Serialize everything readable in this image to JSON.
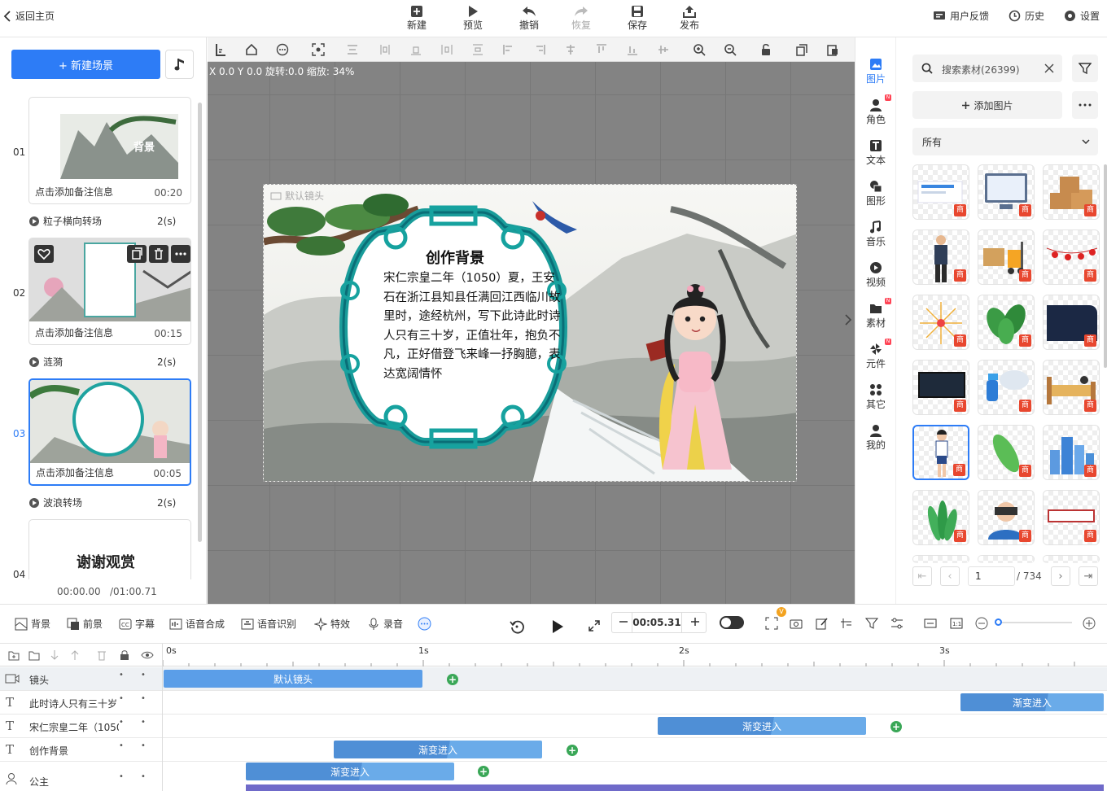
{
  "topbar": {
    "back": "返回主页",
    "new": "新建",
    "preview": "预览",
    "undo": "撤销",
    "redo": "恢复",
    "save": "保存",
    "publish": "发布",
    "feedback": "用户反馈",
    "history": "历史",
    "settings": "设置"
  },
  "left": {
    "new_scene": "+ 新建场景",
    "scenes": [
      {
        "num": "01",
        "note": "点击添加备注信息",
        "time": "00:20",
        "thumb_text": "背景"
      },
      {
        "num": "02",
        "note": "点击添加备注信息",
        "time": "00:15"
      },
      {
        "num": "03",
        "note": "点击添加备注信息",
        "time": "00:05"
      },
      {
        "num": "04",
        "thumb_text": "谢谢观赏"
      }
    ],
    "transitions": [
      {
        "name": "粒子横向转场",
        "dur": "2(s)"
      },
      {
        "name": "涟漪",
        "dur": "2(s)"
      },
      {
        "name": "波浪转场",
        "dur": "2(s)"
      }
    ],
    "time_current": "00:00.00",
    "time_total": "/01:00.71"
  },
  "canvas": {
    "coords": "X 0.0  Y 0.0  旋转:0.0  缩放: 34%",
    "camera_label": "默认镜头",
    "title": "创作背景",
    "body": "宋仁宗皇二年（1050）夏，王安石在浙江县知县任满回江西临川故里时，途经杭州，写下此诗此时诗人只有三十岁，正值壮年，抱负不凡，正好借登飞来峰一抒胸臆，表达宽阔情怀"
  },
  "iconcol": [
    {
      "label": "图片",
      "badge": ""
    },
    {
      "label": "角色",
      "badge": "N"
    },
    {
      "label": "文本",
      "badge": ""
    },
    {
      "label": "图形",
      "badge": ""
    },
    {
      "label": "音乐",
      "badge": ""
    },
    {
      "label": "视频",
      "badge": ""
    },
    {
      "label": "素材",
      "badge": "N"
    },
    {
      "label": "元件",
      "badge": "N"
    },
    {
      "label": "其它",
      "badge": ""
    },
    {
      "label": "我的",
      "badge": ""
    }
  ],
  "assets": {
    "search_placeholder": "搜索素材(26399)",
    "add_image": "添加图片",
    "filter_value": "所有",
    "tag": "商",
    "page": "1",
    "total": "/ 734"
  },
  "bottom": {
    "items": [
      "背景",
      "前景",
      "字幕",
      "语音合成",
      "语音识别",
      "特效",
      "录音"
    ],
    "time": "00:05.31"
  },
  "timeline": {
    "ruler": [
      "0s",
      "1s",
      "2s",
      "3s"
    ],
    "rows": [
      {
        "name": "镜头",
        "bars": [
          {
            "label": "默认镜头"
          }
        ]
      },
      {
        "name": "此时诗人只有三十岁",
        "bars": [
          {
            "label": "渐变进入"
          }
        ]
      },
      {
        "name": "宋仁宗皇二年（1050",
        "bars": [
          {
            "label": "渐变进入"
          }
        ]
      },
      {
        "name": "创作背景",
        "bars": [
          {
            "label": "渐变进入"
          }
        ]
      },
      {
        "name": "公主",
        "bars": [
          {
            "label": "渐变进入"
          }
        ]
      }
    ]
  },
  "colors": {
    "accent": "#2d7cf6",
    "bar": "#5b9ee8",
    "plus": "#3aa757",
    "tag": "#e8472f"
  }
}
